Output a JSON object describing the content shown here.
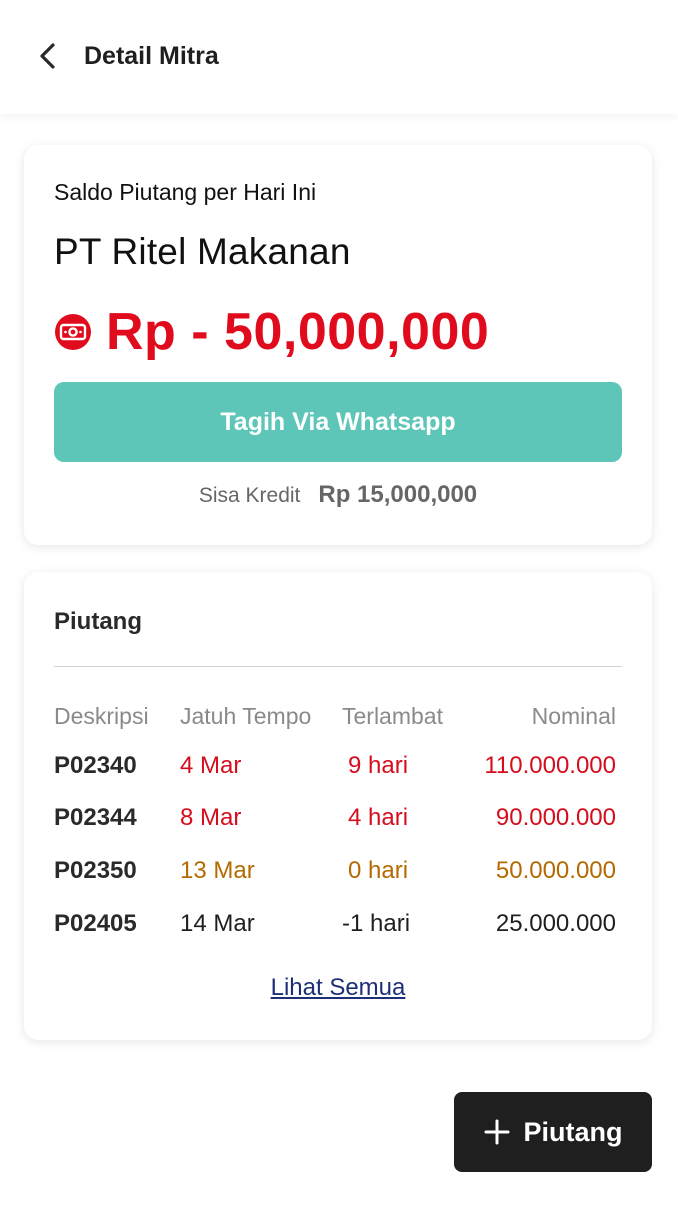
{
  "header": {
    "title": "Detail Mitra",
    "back_icon": "chevron-left-icon"
  },
  "summary": {
    "saldo_label": "Saldo Piutang per Hari Ini",
    "company_name": "PT Ritel Makanan",
    "balance": "Rp - 50,000,000",
    "balance_icon": "money-icon",
    "whatsapp_button": "Tagih Via Whatsapp",
    "sisa_kredit_label": "Sisa Kredit",
    "sisa_kredit_value": "Rp 15,000,000"
  },
  "piutang": {
    "title": "Piutang",
    "columns": [
      "Deskripsi",
      "Jatuh Tempo",
      "Terlambat",
      "Nominal"
    ],
    "rows": [
      {
        "deskripsi": "P02340",
        "jatuh_tempo": "4 Mar",
        "terlambat": "9 hari",
        "nominal": "110.000.000",
        "status_color": "#d50d1d"
      },
      {
        "deskripsi": "P02344",
        "jatuh_tempo": "8 Mar",
        "terlambat": "4 hari",
        "nominal": "90.000.000",
        "status_color": "#d50d1d"
      },
      {
        "deskripsi": "P02350",
        "jatuh_tempo": "13 Mar",
        "terlambat": "0 hari",
        "nominal": "50.000.000",
        "status_color": "#b46a00"
      },
      {
        "deskripsi": "P02405",
        "jatuh_tempo": "14 Mar",
        "terlambat": "-1 hari",
        "nominal": "25.000.000",
        "status_color": "#1f1f1f"
      }
    ],
    "see_all": "Lihat Semua"
  },
  "fab": {
    "label": "Piutang",
    "icon": "plus-icon"
  },
  "colors": {
    "accent": "#5dc6b8",
    "danger": "#e00b1c",
    "warning": "#b46a00",
    "link": "#1e2f78"
  }
}
